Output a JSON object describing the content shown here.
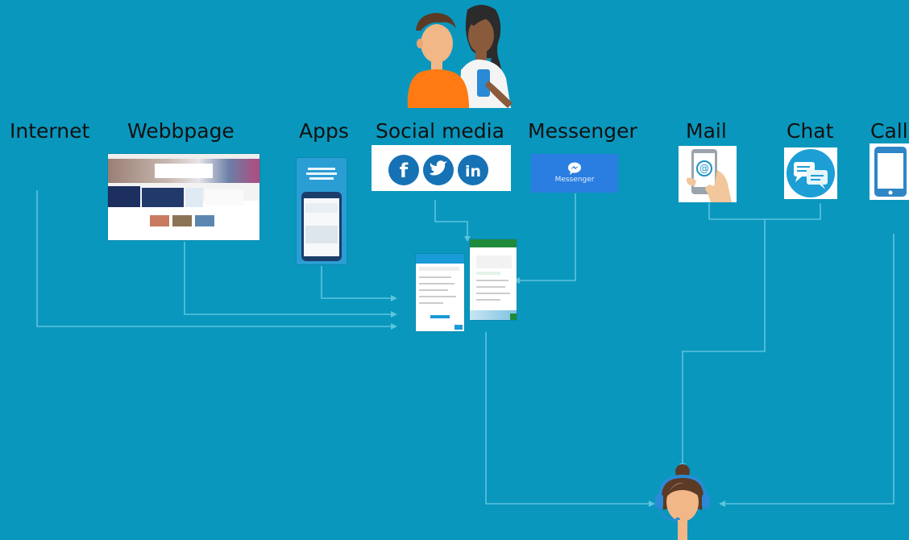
{
  "channels": {
    "internet": "Internet",
    "webbpage": "Webbpage",
    "apps": "Apps",
    "social_media": "Social media",
    "messenger": "Messenger",
    "mail": "Mail",
    "chat": "Chat",
    "call": "Call"
  },
  "messenger_button": {
    "label": "Messenger"
  },
  "social_icons": [
    "facebook-icon",
    "twitter-icon",
    "linkedin-icon"
  ],
  "colors": {
    "background": "#0a97bd",
    "connector": "#5cc4df",
    "social_blue": "#1672b5",
    "messenger_blue": "#2a7de1",
    "chat_green": "#1f8a3a"
  }
}
